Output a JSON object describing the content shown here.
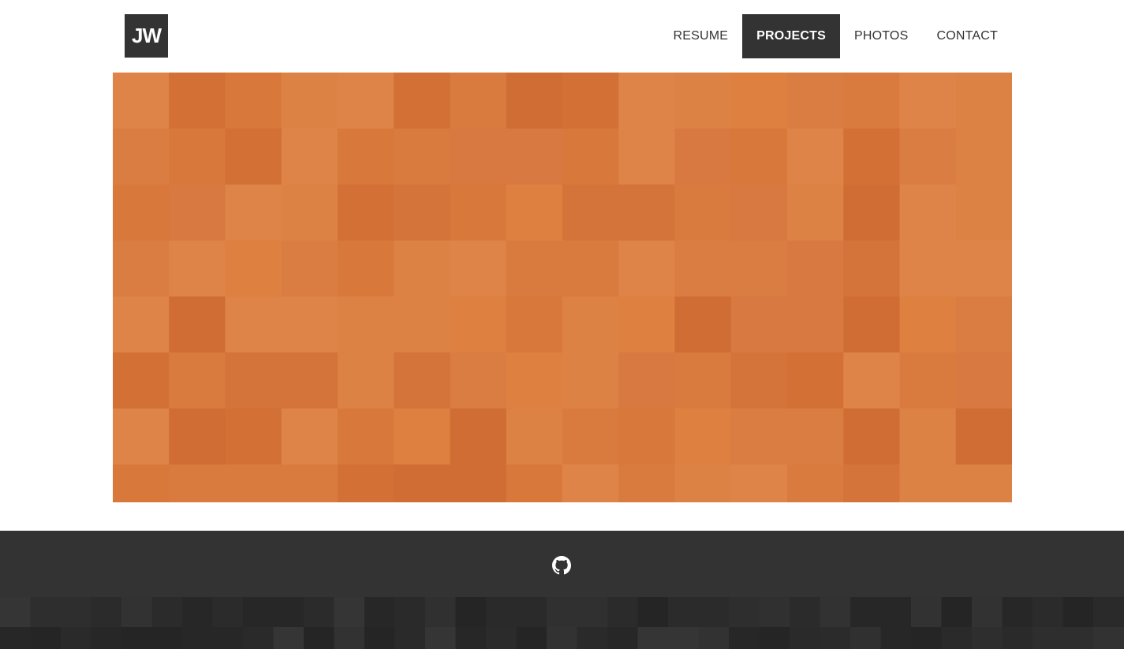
{
  "header": {
    "logo_text": "JW",
    "nav": [
      {
        "label": "RESUME",
        "active": false
      },
      {
        "label": "PROJECTS",
        "active": true
      },
      {
        "label": "PHOTOS",
        "active": false
      },
      {
        "label": "CONTACT",
        "active": false
      }
    ]
  },
  "hero": {
    "icon": "orange-pixel-mosaic",
    "base_color": "#d97b3e"
  },
  "footer": {
    "icons": [
      "github-icon"
    ],
    "background_color": "#333333"
  },
  "colors": {
    "accent_dark": "#333333",
    "mosaic_orange": "#d97b3e"
  }
}
